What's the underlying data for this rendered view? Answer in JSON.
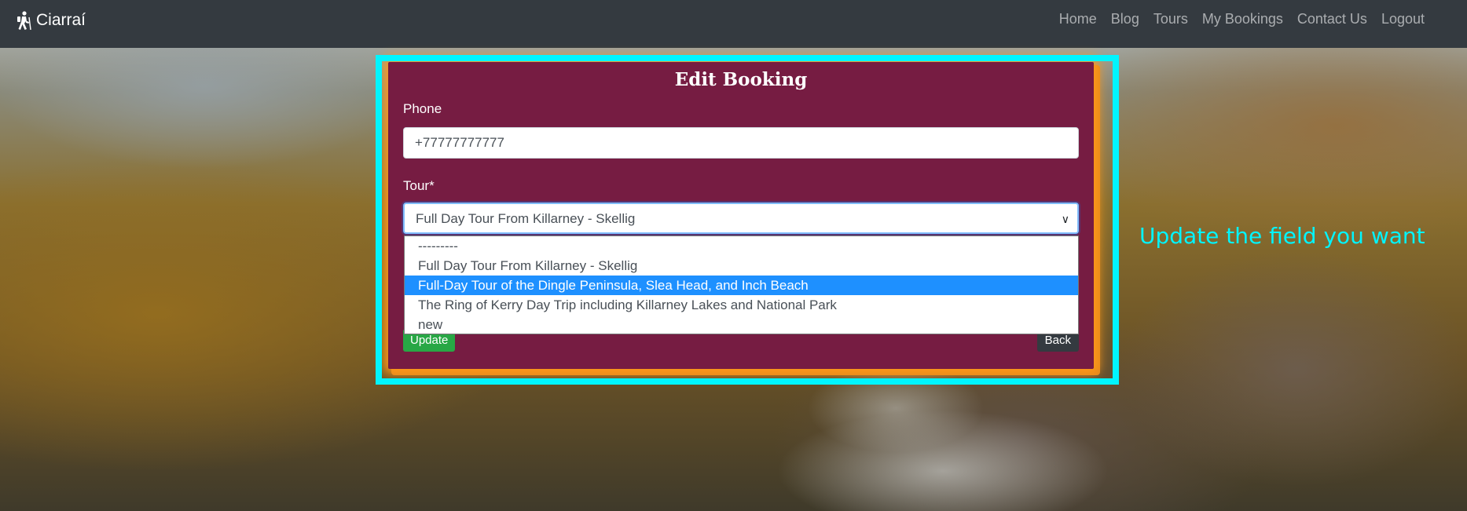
{
  "navbar": {
    "brand": "Ciarraí",
    "links": [
      "Home",
      "Blog",
      "Tours",
      "My Bookings",
      "Contact Us",
      "Logout"
    ]
  },
  "form": {
    "title": "Edit Booking",
    "phone_label": "Phone",
    "phone_value": "+77777777777",
    "tour_label": "Tour*",
    "tour_selected": "Full Day Tour From Killarney - Skellig",
    "tour_options": [
      "---------",
      "Full Day Tour From Killarney - Skellig",
      "Full-Day Tour of the Dingle Peninsula, Slea Head, and Inch Beach",
      "The Ring of Kerry Day Trip including Killarney Lakes and National Park",
      "new"
    ],
    "highlighted_option_index": 2,
    "update_label": "Update",
    "back_label": "Back"
  },
  "annotation": "Update the field you want",
  "colors": {
    "navbar": "#343a40",
    "card": "#761c42",
    "highlight": "#00f5ff",
    "update_button": "#28a745",
    "back_button": "#343a40",
    "selected_option": "#1e90ff"
  }
}
